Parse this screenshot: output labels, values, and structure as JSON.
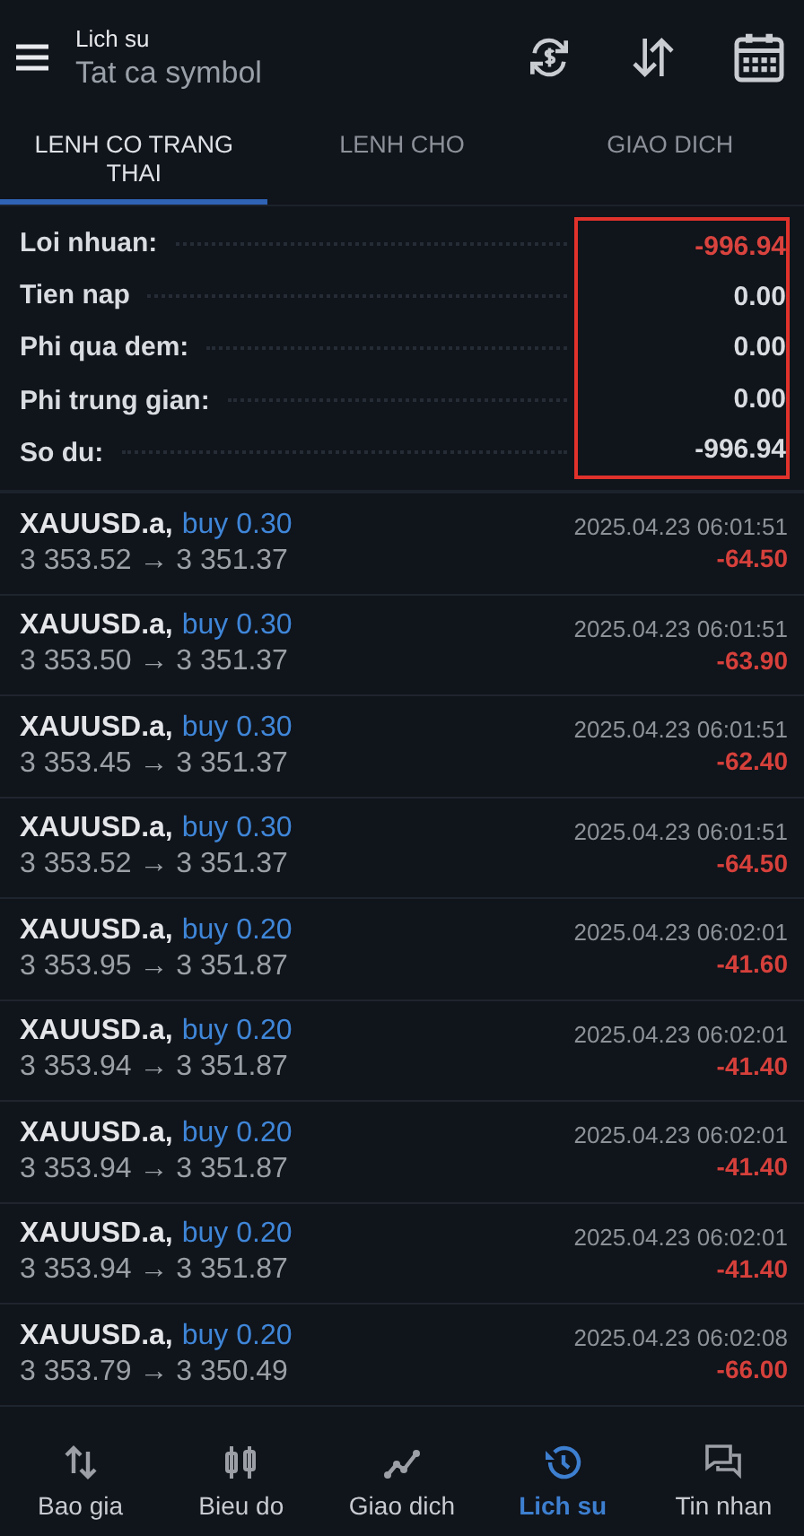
{
  "header": {
    "title": "Lich su",
    "subtitle": "Tat ca symbol"
  },
  "tabs": [
    {
      "label": "LENH CO TRANG THAI",
      "selected": true
    },
    {
      "label": "LENH CHO",
      "selected": false
    },
    {
      "label": "GIAO DICH",
      "selected": false
    }
  ],
  "summary": {
    "highlighted": true,
    "items": [
      {
        "label": "Loi nhuan:",
        "value": "-996.94",
        "negative": true
      },
      {
        "label": "Tien nap",
        "value": "0.00",
        "negative": false
      },
      {
        "label": "Phi qua dem:",
        "value": "0.00",
        "negative": false
      },
      {
        "label": "Phi trung gian:",
        "value": "0.00",
        "negative": false
      },
      {
        "label": "So du:",
        "value": "-996.94",
        "negative": false
      }
    ]
  },
  "deals": [
    {
      "symbol": "XAUUSD.a,",
      "side": "buy 0.30",
      "prices": "3 353.52 → 3 351.37",
      "time": "2025.04.23 06:01:51",
      "profit": "-64.50"
    },
    {
      "symbol": "XAUUSD.a,",
      "side": "buy 0.30",
      "prices": "3 353.50 → 3 351.37",
      "time": "2025.04.23 06:01:51",
      "profit": "-63.90"
    },
    {
      "symbol": "XAUUSD.a,",
      "side": "buy 0.30",
      "prices": "3 353.45 → 3 351.37",
      "time": "2025.04.23 06:01:51",
      "profit": "-62.40"
    },
    {
      "symbol": "XAUUSD.a,",
      "side": "buy 0.30",
      "prices": "3 353.52 → 3 351.37",
      "time": "2025.04.23 06:01:51",
      "profit": "-64.50"
    },
    {
      "symbol": "XAUUSD.a,",
      "side": "buy 0.20",
      "prices": "3 353.95 → 3 351.87",
      "time": "2025.04.23 06:02:01",
      "profit": "-41.60"
    },
    {
      "symbol": "XAUUSD.a,",
      "side": "buy 0.20",
      "prices": "3 353.94 → 3 351.87",
      "time": "2025.04.23 06:02:01",
      "profit": "-41.40"
    },
    {
      "symbol": "XAUUSD.a,",
      "side": "buy 0.20",
      "prices": "3 353.94 → 3 351.87",
      "time": "2025.04.23 06:02:01",
      "profit": "-41.40"
    },
    {
      "symbol": "XAUUSD.a,",
      "side": "buy 0.20",
      "prices": "3 353.94 → 3 351.87",
      "time": "2025.04.23 06:02:01",
      "profit": "-41.40"
    },
    {
      "symbol": "XAUUSD.a,",
      "side": "buy 0.20",
      "prices": "3 353.79 → 3 350.49",
      "time": "2025.04.23 06:02:08",
      "profit": "-66.00"
    }
  ],
  "nav": [
    {
      "label": "Bao gia",
      "kind": "quotes",
      "selected": false
    },
    {
      "label": "Bieu do",
      "kind": "chart",
      "selected": false
    },
    {
      "label": "Giao dich",
      "kind": "trade",
      "selected": false
    },
    {
      "label": "Lich su",
      "kind": "history",
      "selected": true
    },
    {
      "label": "Tin nhan",
      "kind": "messages",
      "selected": false
    }
  ]
}
